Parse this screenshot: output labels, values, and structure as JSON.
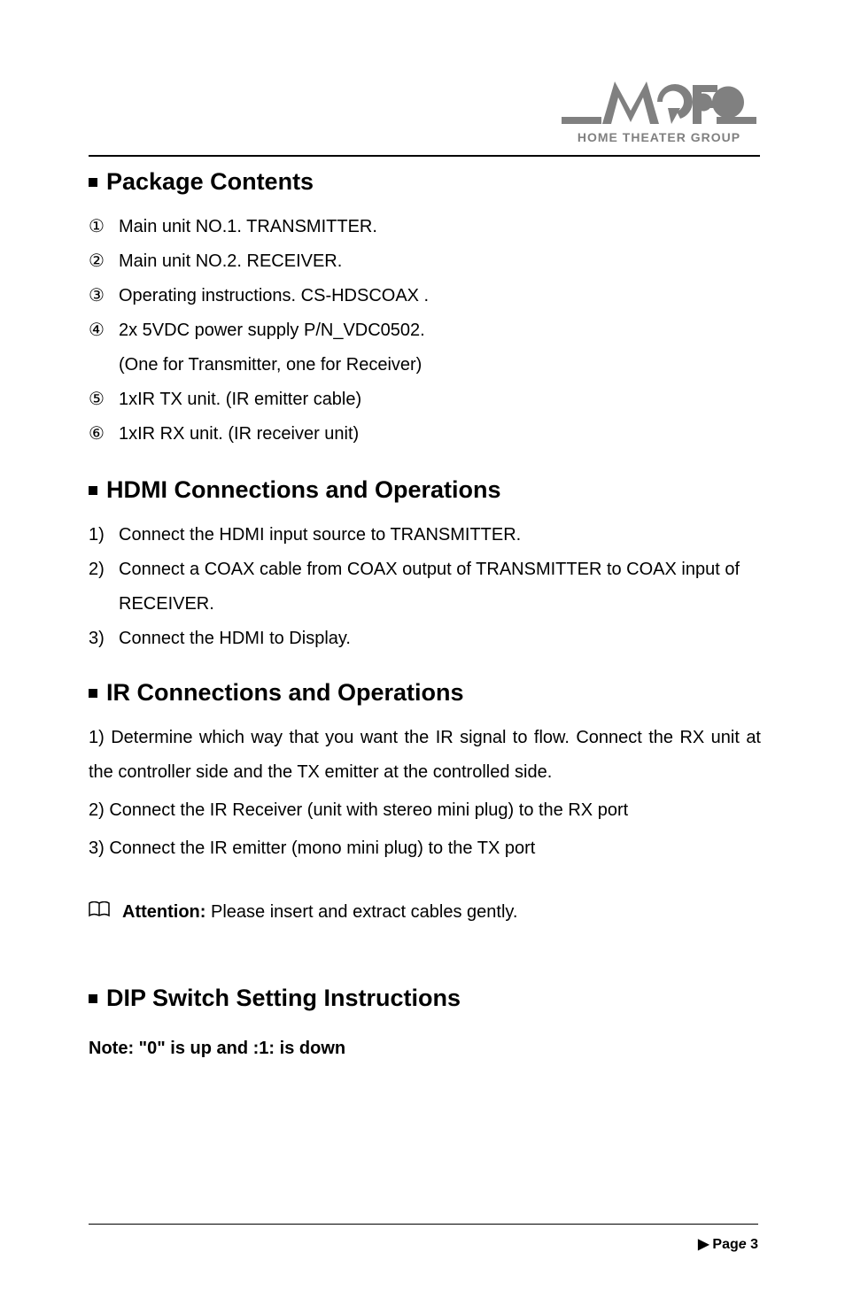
{
  "logo": {
    "subtitle": "HOME THEATER GROUP"
  },
  "sections": {
    "package": {
      "heading": "Package Contents",
      "items": [
        {
          "marker": "①",
          "text": "Main unit NO.1. TRANSMITTER."
        },
        {
          "marker": "②",
          "text": "Main unit NO.2. RECEIVER."
        },
        {
          "marker": "③",
          "text": "Operating instructions. CS-HDSCOAX ."
        },
        {
          "marker": "④",
          "text": "2x 5VDC power supply P/N_VDC0502."
        },
        {
          "marker": "",
          "text": "(One for Transmitter, one for Receiver)"
        },
        {
          "marker": "⑤",
          "text": "1xIR TX unit. (IR emitter cable)"
        },
        {
          "marker": "⑥",
          "text": "1xIR RX unit. (IR receiver unit)"
        }
      ]
    },
    "hdmi": {
      "heading": "HDMI Connections and Operations",
      "items": [
        {
          "marker": "1)",
          "text": "Connect the HDMI input source to TRANSMITTER."
        },
        {
          "marker": "2)",
          "text": "Connect a COAX cable from COAX output of TRANSMITTER to COAX input of RECEIVER."
        },
        {
          "marker": "3)",
          "text": "Connect the HDMI to Display."
        }
      ]
    },
    "ir": {
      "heading": "IR Connections and Operations",
      "paragraphs": [
        "1) Determine which way that you want the IR signal to flow. Connect the RX unit at the controller side and the TX emitter at the controlled side.",
        "2) Connect the IR Receiver (unit with stereo mini plug) to the RX port",
        "3) Connect the IR emitter (mono mini plug) to the TX port"
      ]
    },
    "attention": {
      "label": "Attention:",
      "text": " Please insert and extract cables gently."
    },
    "dip": {
      "heading": "DIP Switch Setting Instructions",
      "note": "Note: \"0\" is up and :1: is down"
    }
  },
  "footer": {
    "arrow": "▶",
    "page_label": "Pag",
    "page_label_italic": "e",
    "page_number": " 3"
  }
}
